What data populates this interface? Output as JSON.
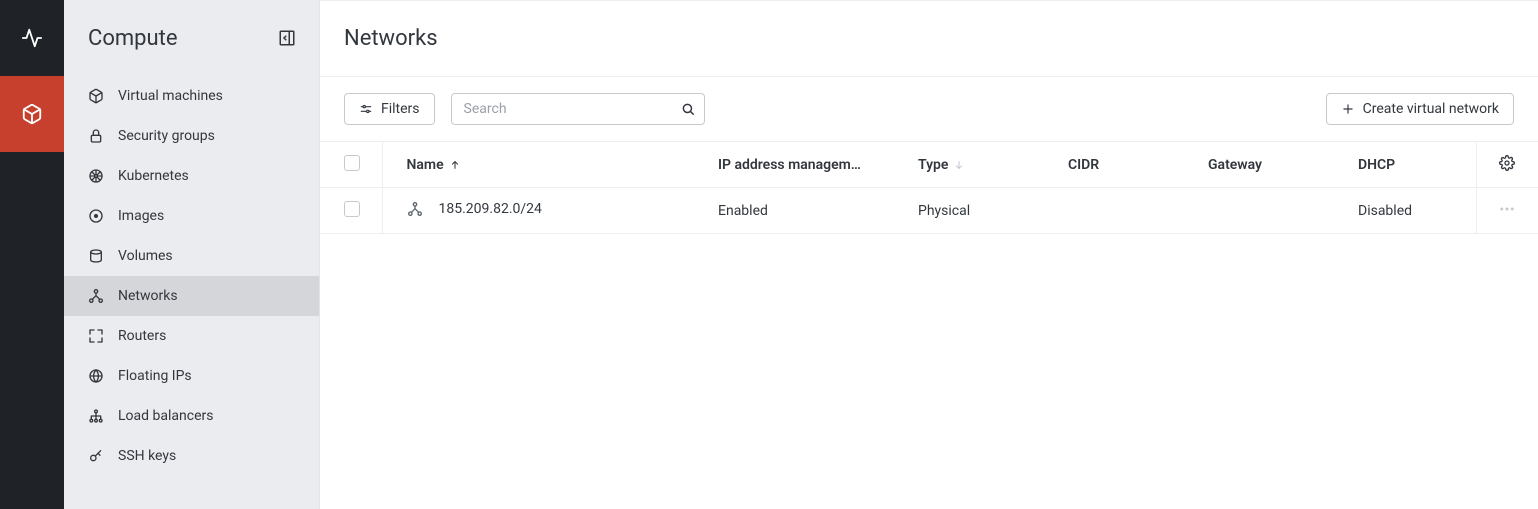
{
  "rail": {
    "items": [
      {
        "name": "status-icon",
        "active": false
      },
      {
        "name": "compute-icon",
        "active": true
      }
    ]
  },
  "sidebar": {
    "title": "Compute",
    "items": [
      {
        "label": "Virtual machines",
        "icon": "cube-icon"
      },
      {
        "label": "Security groups",
        "icon": "lock-icon"
      },
      {
        "label": "Kubernetes",
        "icon": "helm-icon"
      },
      {
        "label": "Images",
        "icon": "disc-icon"
      },
      {
        "label": "Volumes",
        "icon": "drive-icon"
      },
      {
        "label": "Networks",
        "icon": "network-icon",
        "active": true
      },
      {
        "label": "Routers",
        "icon": "expand-icon"
      },
      {
        "label": "Floating IPs",
        "icon": "globe-icon"
      },
      {
        "label": "Load balancers",
        "icon": "sitemap-icon"
      },
      {
        "label": "SSH keys",
        "icon": "key-icon"
      }
    ]
  },
  "page": {
    "title": "Networks"
  },
  "toolbar": {
    "filters_label": "Filters",
    "search_placeholder": "Search",
    "create_label": "Create virtual network"
  },
  "table": {
    "columns": {
      "name": "Name",
      "ipam": "IP address managem…",
      "type": "Type",
      "cidr": "CIDR",
      "gateway": "Gateway",
      "dhcp": "DHCP"
    },
    "rows": [
      {
        "name": "185.209.82.0/24",
        "ipam": "Enabled",
        "type": "Physical",
        "cidr": "",
        "gateway": "",
        "dhcp": "Disabled"
      }
    ]
  }
}
